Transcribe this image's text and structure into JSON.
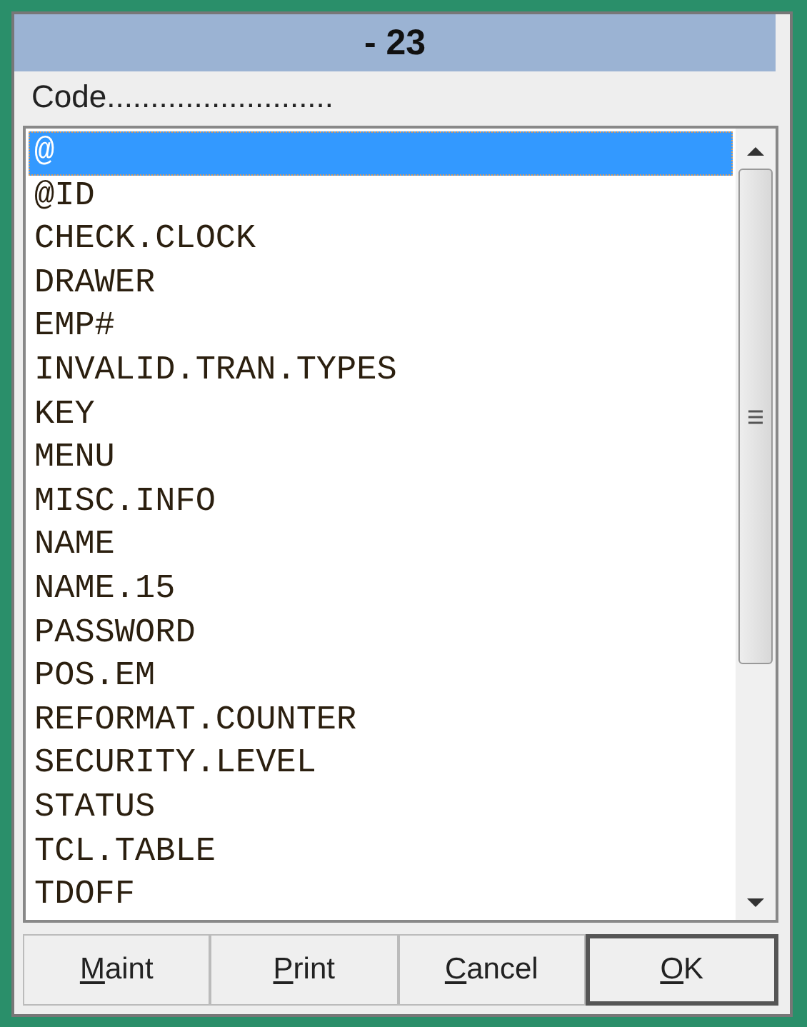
{
  "dialog": {
    "title": "- 23",
    "field_label": "Code.........................."
  },
  "list_items": [
    {
      "label": "@",
      "selected": true
    },
    {
      "label": "@ID",
      "selected": false
    },
    {
      "label": "CHECK.CLOCK",
      "selected": false
    },
    {
      "label": "DRAWER",
      "selected": false
    },
    {
      "label": "EMP#",
      "selected": false
    },
    {
      "label": "INVALID.TRAN.TYPES",
      "selected": false
    },
    {
      "label": "KEY",
      "selected": false
    },
    {
      "label": "MENU",
      "selected": false
    },
    {
      "label": "MISC.INFO",
      "selected": false
    },
    {
      "label": "NAME",
      "selected": false
    },
    {
      "label": "NAME.15",
      "selected": false
    },
    {
      "label": "PASSWORD",
      "selected": false
    },
    {
      "label": "POS.EM",
      "selected": false
    },
    {
      "label": "REFORMAT.COUNTER",
      "selected": false
    },
    {
      "label": "SECURITY.LEVEL",
      "selected": false
    },
    {
      "label": "STATUS",
      "selected": false
    },
    {
      "label": "TCL.TABLE",
      "selected": false
    },
    {
      "label": "TDOFF",
      "selected": false
    }
  ],
  "buttons": [
    {
      "label": "Maint",
      "default": false
    },
    {
      "label": "Print",
      "default": false
    },
    {
      "label": "Cancel",
      "default": false
    },
    {
      "label": "OK",
      "default": true
    }
  ]
}
